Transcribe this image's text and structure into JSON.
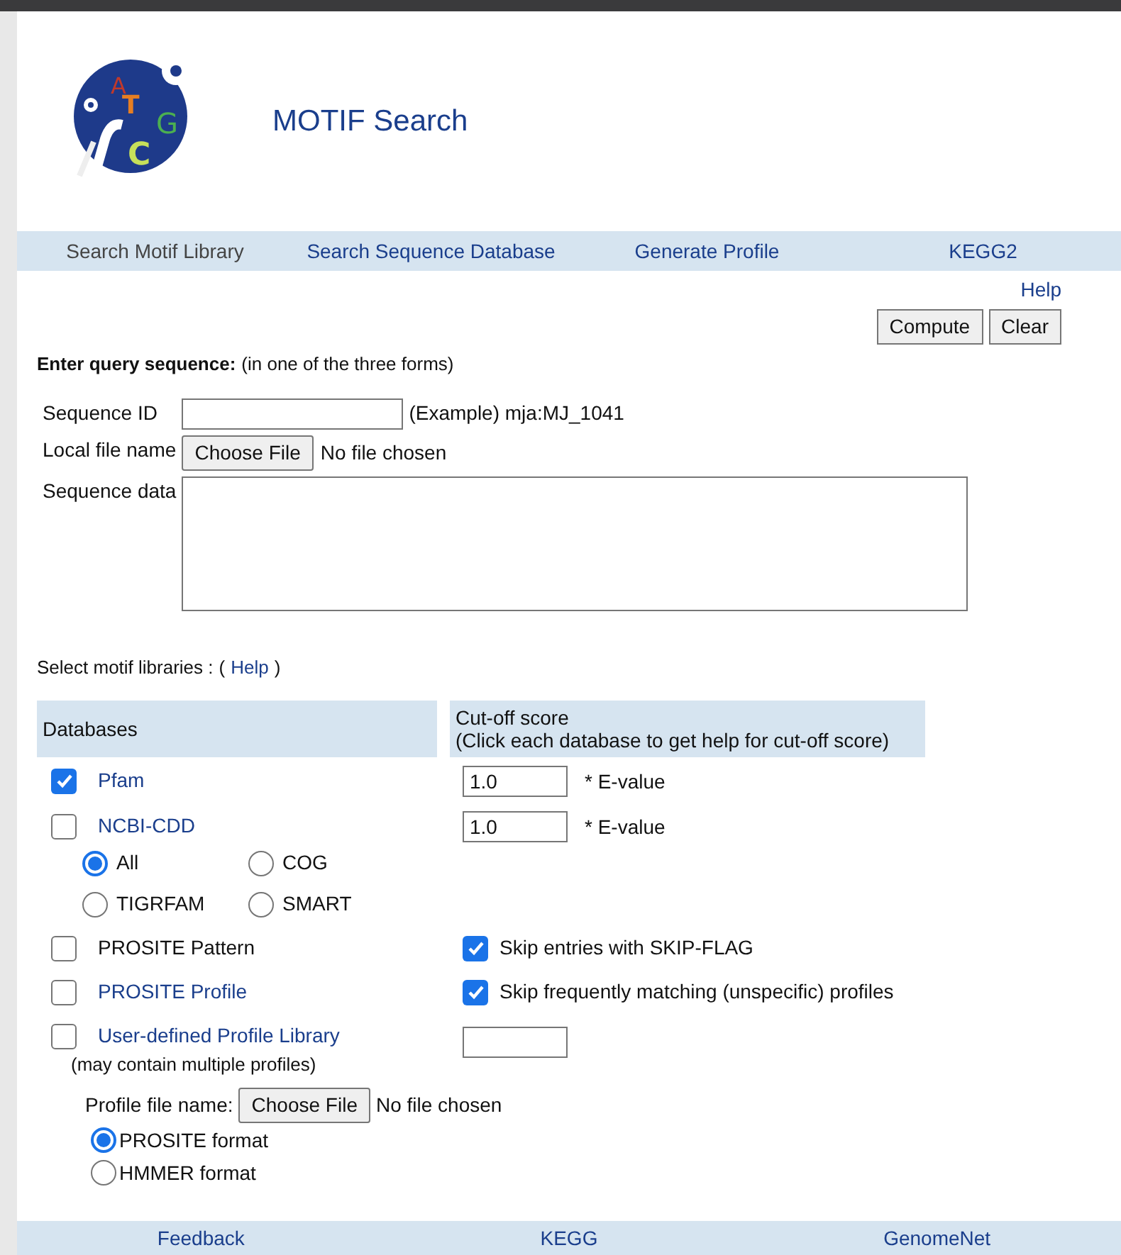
{
  "logo": {
    "letters": [
      {
        "char": "A",
        "color": "#c0392b"
      },
      {
        "char": "T",
        "color": "#e67e22"
      },
      {
        "char": "G",
        "color": "#4caf50"
      },
      {
        "char": "C",
        "color": "#c6e05a"
      }
    ]
  },
  "title": "MOTIF Search",
  "nav": [
    {
      "label": "Search Motif Library",
      "selected": true
    },
    {
      "label": "Search Sequence Database",
      "selected": false
    },
    {
      "label": "Generate Profile",
      "selected": false
    },
    {
      "label": "KEGG2",
      "selected": false
    }
  ],
  "help_link": "Help",
  "buttons": [
    "Compute",
    "Clear"
  ],
  "query": {
    "heading": "Enter query sequence:",
    "hint": "(in one of the three forms)",
    "sequence_id_label": "Sequence ID",
    "example": "(Example) mja:MJ_1041",
    "file_label": "Local file name",
    "file_button": "Choose File",
    "file_status": "No file chosen",
    "data_label": "Sequence data"
  },
  "libraries": {
    "heading": "Select motif libraries :",
    "open_paren": "(",
    "help": "Help",
    "close_paren": ")",
    "col_databases": "Databases",
    "col_cutoff": "Cut-off score",
    "col_cutoff_note": "(Click each database to get help for cut-off score)"
  },
  "databases": [
    {
      "kind": "evalue",
      "name": "Pfam",
      "link": true,
      "checked": true,
      "value": "1.0",
      "unit": "* E-value"
    },
    {
      "kind": "evalue",
      "name": "NCBI-CDD",
      "link": true,
      "checked": false,
      "value": "1.0",
      "unit": "* E-value",
      "options": [
        {
          "label": "All",
          "selected": true
        },
        {
          "label": "COG",
          "selected": false
        },
        {
          "label": "TIGRFAM",
          "selected": false
        },
        {
          "label": "SMART",
          "selected": false
        }
      ]
    },
    {
      "kind": "skip",
      "name": "PROSITE Pattern",
      "link": false,
      "checked": false,
      "skip_label": "Skip entries with SKIP-FLAG",
      "skip_checked": true
    },
    {
      "kind": "skip",
      "name": "PROSITE Profile",
      "link": true,
      "checked": false,
      "skip_label": "Skip frequently matching (unspecific) profiles",
      "skip_checked": true
    },
    {
      "kind": "custom",
      "name": "User-defined Profile Library",
      "link": true,
      "checked": false,
      "note": "(may contain multiple profiles)",
      "file_label": "Profile file name:",
      "file_button": "Choose File",
      "file_status": "No file chosen",
      "formats": [
        {
          "label": "PROSITE format",
          "selected": true
        },
        {
          "label": "HMMER format",
          "selected": false
        }
      ]
    }
  ],
  "footer": [
    "Feedback",
    "KEGG",
    "GenomeNet"
  ]
}
